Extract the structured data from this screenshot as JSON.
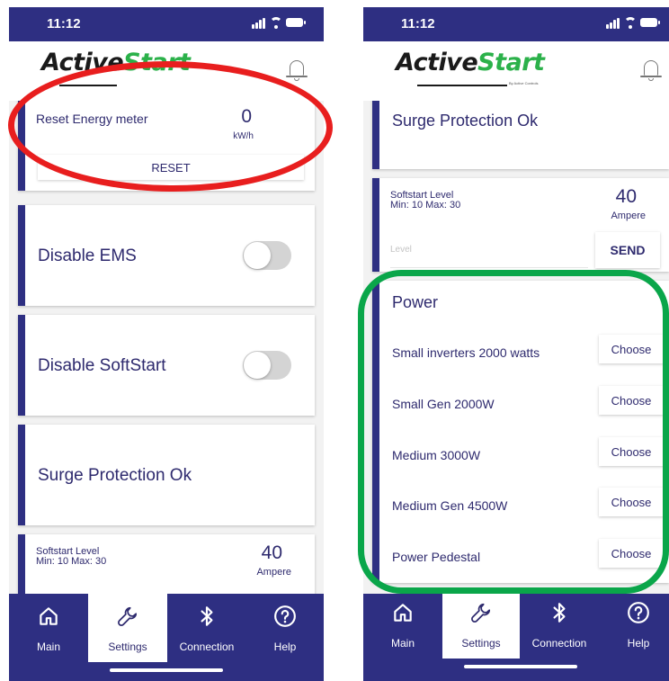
{
  "status": {
    "time": "11:12"
  },
  "header": {
    "brand_part1": "Active",
    "brand_part2": "Start",
    "brand_sub": "By Active Controls"
  },
  "energy": {
    "label": "Reset Energy meter",
    "value": "0",
    "unit": "kW/h",
    "reset_label": "RESET"
  },
  "toggles": {
    "disable_ems": "Disable EMS",
    "disable_softstart": "Disable SoftStart"
  },
  "surge": {
    "label": "Surge Protection Ok"
  },
  "softstart": {
    "title_line1": "Softstart Level",
    "title_line2": "Min: 10  Max: 30",
    "value": "40",
    "unit": "Ampere",
    "input_placeholder": "Level",
    "send_label": "SEND"
  },
  "power": {
    "title": "Power",
    "options": [
      {
        "label": "Small inverters 2000 watts",
        "button": "Choose"
      },
      {
        "label": "Small Gen 2000W",
        "button": "Choose"
      },
      {
        "label": "Medium 3000W",
        "button": "Choose"
      },
      {
        "label": "Medium Gen 4500W",
        "button": "Choose"
      },
      {
        "label": "Power Pedestal",
        "button": "Choose"
      }
    ]
  },
  "tabs": [
    {
      "label": "Main",
      "icon": "home-icon"
    },
    {
      "label": "Settings",
      "icon": "wrench-icon",
      "active": true
    },
    {
      "label": "Connection",
      "icon": "bluetooth-icon"
    },
    {
      "label": "Help",
      "icon": "help-icon"
    }
  ],
  "colors": {
    "primary": "#2e2f82",
    "brand_green": "#2bb14a",
    "annotation_red": "#e81e1e",
    "annotation_green": "#0aa64a"
  }
}
